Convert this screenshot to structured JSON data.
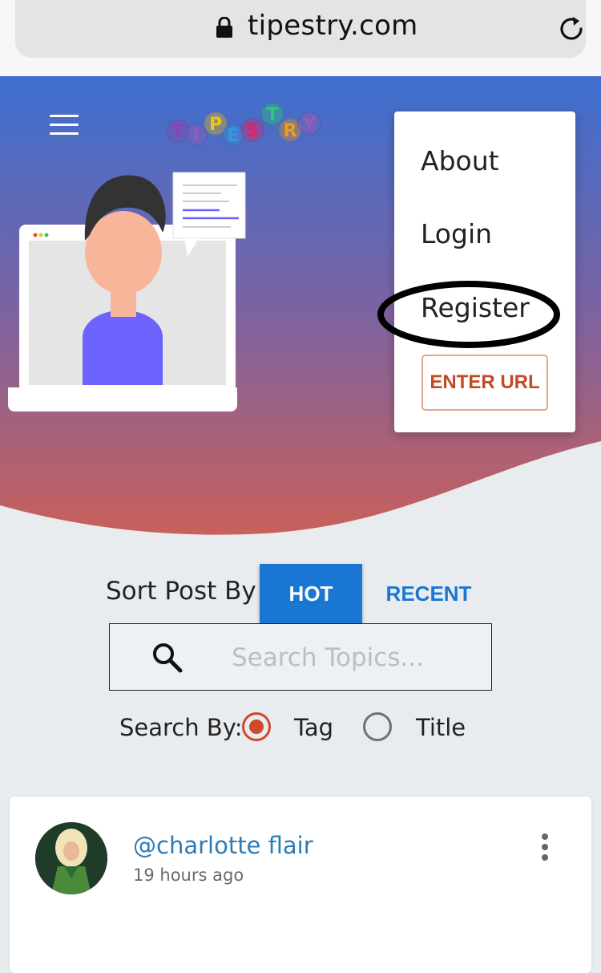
{
  "browser": {
    "url": "tipestry.com",
    "lock_icon": "lock-icon",
    "reload_icon": "reload-icon"
  },
  "header": {
    "logo_letters": [
      "T",
      "I",
      "P",
      "E",
      "S",
      "T",
      "R",
      "Y"
    ],
    "logo_colors": [
      "#8e44ad",
      "#9b59b6",
      "#f1c40f",
      "#3498db",
      "#e91e63",
      "#2ecc71",
      "#f39c12",
      "#9b59b6"
    ]
  },
  "menu": {
    "about": "About",
    "login": "Login",
    "register": "Register",
    "enter_url": "ENTER URL"
  },
  "sort": {
    "label": "Sort Post By",
    "hot": "HOT",
    "recent": "RECENT",
    "active": "HOT"
  },
  "search": {
    "placeholder": "Search Topics..."
  },
  "search_by": {
    "label": "Search By:",
    "tag": "Tag",
    "title": "Title",
    "selected": "Tag"
  },
  "post": {
    "username": "@charlotte flair",
    "time": "19 hours ago"
  },
  "colors": {
    "primary": "#1976d2",
    "accent": "#c24b24",
    "hero_top": "#3d6fd0",
    "hero_bottom": "#c9605a",
    "link": "#2c7bb8"
  }
}
